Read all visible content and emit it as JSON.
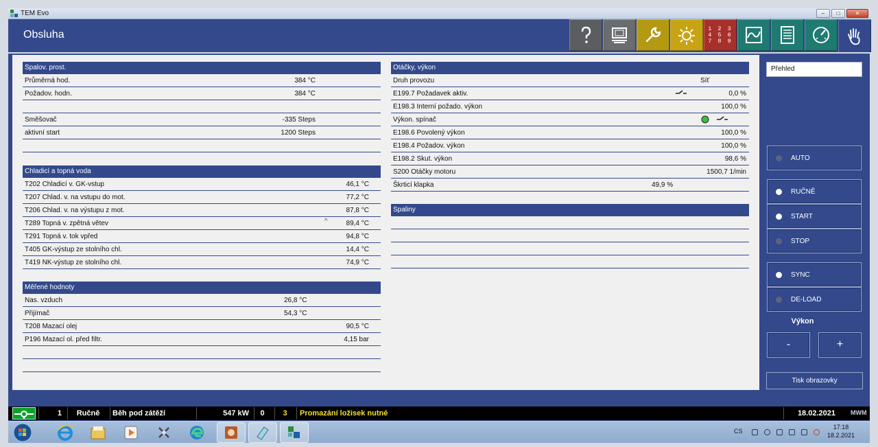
{
  "window": {
    "title": "TEM Evo"
  },
  "header": {
    "title": "Obsluha",
    "buttons": [
      {
        "name": "help",
        "icon": "question-icon",
        "color": "#5b5d60"
      },
      {
        "name": "monitor",
        "icon": "monitor-icon",
        "color": "#6a6c70"
      },
      {
        "name": "service",
        "icon": "wrench-icon",
        "color": "#b39a12"
      },
      {
        "name": "lamp",
        "icon": "sun-icon",
        "color": "#c7a414"
      },
      {
        "name": "numbers",
        "icon": "numpad-icon",
        "color": "#a8302b",
        "text": "1 2 3 4 5 6 7 8 9"
      },
      {
        "name": "trend",
        "icon": "wave-icon",
        "color": "#1f7a72"
      },
      {
        "name": "list",
        "icon": "list-icon",
        "color": "#1f7a72"
      },
      {
        "name": "gauge",
        "icon": "gauge-icon",
        "color": "#1f7a72"
      },
      {
        "name": "operation",
        "icon": "hand-icon",
        "color": "#33498c"
      }
    ]
  },
  "spalov": {
    "title": "Spalov. prost.",
    "rows": [
      {
        "label": "Průměrná hod.",
        "value": "384 °C"
      },
      {
        "label": "Požadov. hodn.",
        "value": "384 °C"
      },
      {
        "label": "",
        "value": ""
      },
      {
        "label": "Směšovač",
        "value": "-335 Steps"
      },
      {
        "label": "aktivní start",
        "value": "1200 Steps"
      },
      {
        "label": "",
        "value": ""
      }
    ]
  },
  "chladici": {
    "title": "Chladicí a topná voda",
    "rows": [
      {
        "label": "T202 Chladicí v. GK-vstup",
        "value": "46,1 °C"
      },
      {
        "label": "T207 Chlad. v. na vstupu do mot.",
        "value": "77,2 °C"
      },
      {
        "label": "T206 Chlad. v. na výstupu z mot.",
        "value": "87,8 °C"
      },
      {
        "label": "T289 Topná v. zpětná větev",
        "value": "89,4 °C",
        "marker": "^"
      },
      {
        "label": "T291 Topná v. tok vpřed",
        "value": "94,8 °C"
      },
      {
        "label": "T405 GK-výstup ze stolního chl.",
        "value": "14,4 °C"
      },
      {
        "label": "T419 NK-výstup ze stolního chl.",
        "value": "74,9 °C"
      }
    ]
  },
  "merene": {
    "title": "Měřené hodnoty",
    "rows": [
      {
        "label": "Nas. vzduch",
        "value": "26,8 °C",
        "col": "mid"
      },
      {
        "label": "Přijímač",
        "value": "54,3 °C",
        "col": "mid"
      },
      {
        "label": "T208 Mazací olej",
        "value": "90,5 °C"
      },
      {
        "label": "P196 Mazací ol. před filtr.",
        "value": "4,15 bar"
      },
      {
        "label": "",
        "value": ""
      },
      {
        "label": "",
        "value": ""
      }
    ]
  },
  "otacky": {
    "title": "Otáčky, výkon",
    "rows": [
      {
        "label": "Druh provozu",
        "value": "",
        "mid": "Síť"
      },
      {
        "label": "E199.7 Požadavek aktiv.",
        "value": "0,0 %"
      },
      {
        "label": "E198.3 Interní požado. výkon",
        "value": "100,0 %"
      },
      {
        "label": "Výkon. spínač",
        "value": ""
      },
      {
        "label": "E198.6 Povolený výkon",
        "value": "100,0 %"
      },
      {
        "label": "E198.4 Požadov. výkon",
        "value": "100,0 %"
      },
      {
        "label": "E198.2 Skut. výkon",
        "value": "98,6 %"
      },
      {
        "label": "S200 Otáčky motoru",
        "value": "1500,7 1/min"
      },
      {
        "label": "Škrticí klapka",
        "value": "",
        "mid": "49,9 %"
      }
    ]
  },
  "spaliny": {
    "title": "Spaliny"
  },
  "sidebar": {
    "prehled": "Přehled",
    "buttons": [
      {
        "label": "AUTO",
        "lamp": "#5b6480"
      },
      {
        "label": "RUČNĚ",
        "lamp": "#ffffff"
      },
      {
        "label": "START",
        "lamp": "#ffffff"
      },
      {
        "label": "STOP",
        "lamp": "#5b6480"
      },
      {
        "label": "SYNC",
        "lamp": "#ffffff"
      },
      {
        "label": "DE-LOAD",
        "lamp": "#5b6480"
      }
    ],
    "vykon_label": "Výkon",
    "minus": "-",
    "plus": "+",
    "tisk": "Tisk obrazovky"
  },
  "status": {
    "count": "1",
    "mode": "Ručně",
    "state": "Běh pod zátěží",
    "power": "547 kW",
    "n0": "0",
    "n3": "3",
    "message": "Promazání ložisek nutné",
    "date": "18.02.2021",
    "logo": "MWM"
  },
  "taskbar": {
    "lang": "CS",
    "time": "17:18",
    "date": "18.2.2021"
  }
}
